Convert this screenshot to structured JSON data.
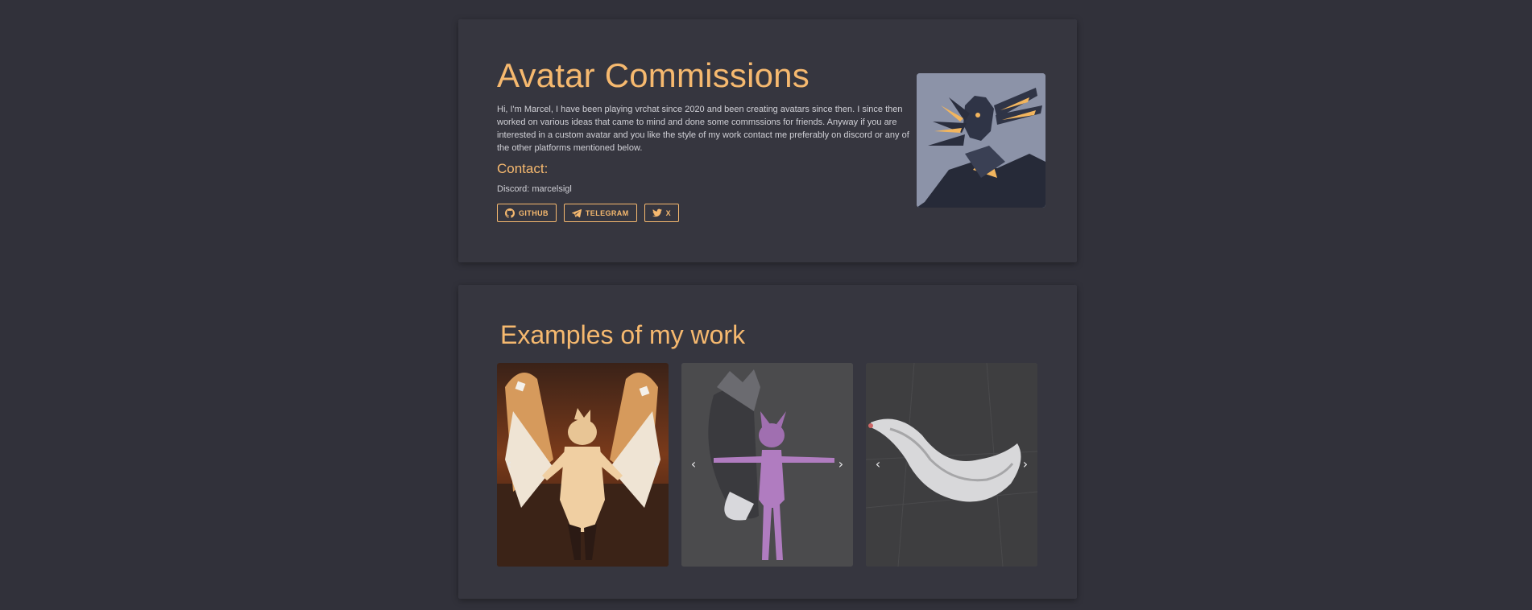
{
  "hero": {
    "title": "Avatar Commissions",
    "intro": "Hi, I'm Marcel, I have been playing vrchat since 2020 and been creating avatars since then. I since then worked on various ideas that came to mind and done some commssions for friends. Anyway if you are interested in a custom avatar and you like the style of my work contact me preferably on discord or any of the other platforms mentioned below.",
    "contact_heading": "Contact:",
    "discord_label": "Discord:",
    "discord_value": "marcelsigl",
    "buttons": [
      {
        "label": "GITHUB",
        "icon": "github-icon"
      },
      {
        "label": "TELEGRAM",
        "icon": "telegram-icon"
      },
      {
        "label": "X",
        "icon": "twitter-bird-icon"
      }
    ]
  },
  "examples": {
    "title": "Examples of my work",
    "slides": [
      {
        "subject": "avatar-with-wings",
        "prev": "‹",
        "next": "›"
      },
      {
        "subject": "purple-fox-avatar",
        "prev": "‹",
        "next": "›"
      },
      {
        "subject": "fluffy-tail-model",
        "prev": "‹",
        "next": "›"
      }
    ]
  },
  "colors": {
    "background": "#31313a",
    "card": "#36363f",
    "accent": "#f6b96f",
    "text": "#d0d0d6"
  }
}
